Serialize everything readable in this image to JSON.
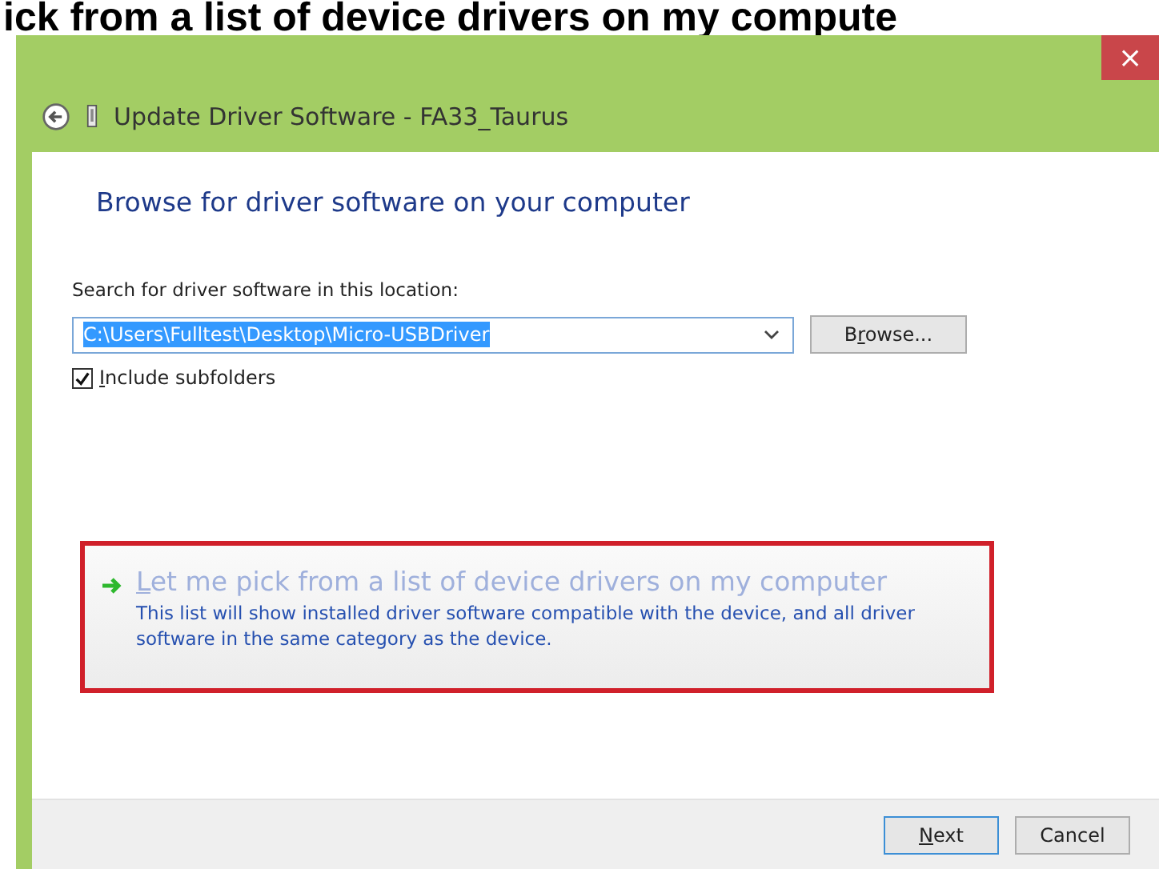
{
  "caption": "ick from a list of device drivers on my compute",
  "window": {
    "title": "Update Driver Software - FA33_Taurus",
    "close": "×"
  },
  "heading": "Browse for driver software on your computer",
  "location": {
    "label": "Search for driver software in this location:",
    "value": "C:\\Users\\Fulltest\\Desktop\\Micro-USBDriver",
    "browse": "Browse..."
  },
  "include_subfolders": {
    "label": "Include subfolders",
    "checked": true
  },
  "option": {
    "title": "Let me pick from a list of device drivers on my computer",
    "description": "This list will show installed driver software compatible with the device, and all driver software in the same category as the device.",
    "highlighted": true
  },
  "buttons": [
    {
      "label": "Next",
      "default": true
    },
    {
      "label": "Cancel",
      "default": false
    }
  ]
}
